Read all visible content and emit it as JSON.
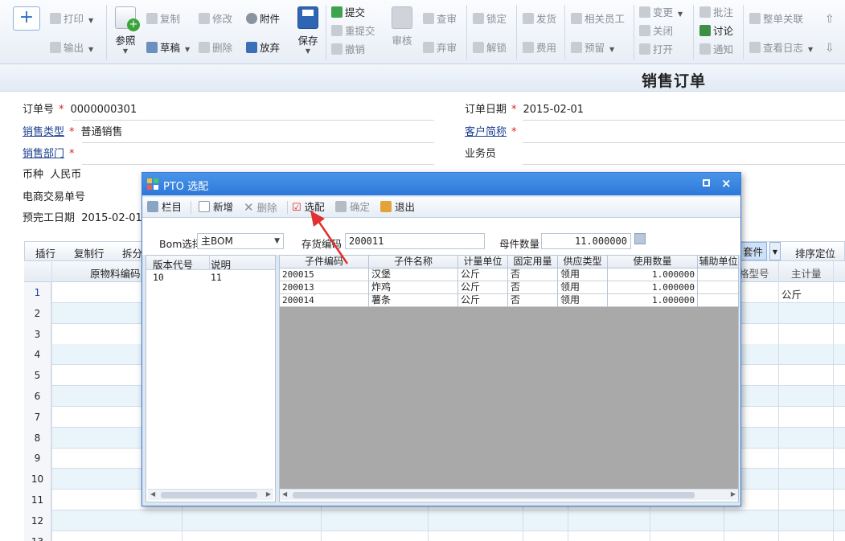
{
  "toolbar": {
    "add_symbol": "+",
    "print": "打印",
    "output": "输出",
    "reference": "参照",
    "copy": "复制",
    "draft": "草稿",
    "modify": "修改",
    "delete": "删除",
    "attach": "附件",
    "abandon": "放弃",
    "save": "保存",
    "submit": "提交",
    "resubmit": "重提交",
    "withdraw": "撤销",
    "audit": "审核",
    "review": "查审",
    "discard": "弃审",
    "lock": "锁定",
    "unlock": "解锁",
    "ship": "发货",
    "cost": "费用",
    "related": "相关员工",
    "reserve": "预留",
    "change": "变更",
    "close": "关闭",
    "open": "打开",
    "annotate": "批注",
    "discuss": "讨论",
    "notify": "通知",
    "whole_link": "整单关联",
    "view_log": "查看日志"
  },
  "form": {
    "title": "销售订单",
    "order_no_label": "订单号",
    "order_no": "0000000301",
    "order_date_label": "订单日期",
    "order_date": "2015-02-01",
    "sales_type_label": "销售类型",
    "sales_type": "普通销售",
    "customer_label": "客户简称",
    "customer": "",
    "dept_label": "销售部门",
    "dept": "",
    "salesman_label": "业务员",
    "salesman": "",
    "currency_label": "币种",
    "currency": "人民币",
    "ecommerce_label": "电商交易单号",
    "ecommerce": "",
    "finish_date_label": "预完工日期",
    "finish_date": "2015-02-01",
    "required_mark": "*"
  },
  "grid": {
    "tabs": [
      "插行",
      "复制行",
      "拆分"
    ],
    "tab_kit": "套件",
    "tab_sort": "排序定位",
    "col_material": "原物料编码",
    "col_spec": "格型号",
    "col_unit": "主计量",
    "row1_unit": "公斤",
    "row_numbers": [
      "1",
      "2",
      "3",
      "4",
      "5",
      "6",
      "7",
      "8",
      "9",
      "10",
      "11",
      "12",
      "13"
    ]
  },
  "dialog": {
    "title": "PTO 选配",
    "close_symbol": "×",
    "toolbar": {
      "columns": "栏目",
      "new": "新增",
      "delete": "删除",
      "select": "选配",
      "confirm": "确定",
      "exit": "退出"
    },
    "bom_label": "Bom选择",
    "bom_value": "主BOM",
    "stock_code_label": "存货编码",
    "stock_code": "200011",
    "parent_qty_label": "母件数量",
    "parent_qty": "11.000000",
    "left_table": {
      "headers": [
        "版本代号",
        "说明"
      ],
      "rows": [
        [
          "10",
          "11"
        ]
      ]
    },
    "right_table": {
      "headers": [
        "子件编码",
        "子件名称",
        "计量单位",
        "固定用量",
        "供应类型",
        "使用数量",
        "辅助单位"
      ],
      "rows": [
        [
          "200015",
          "汉堡",
          "公斤",
          "否",
          "领用",
          "1.000000"
        ],
        [
          "200013",
          "炸鸡",
          "公斤",
          "否",
          "领用",
          "1.000000"
        ],
        [
          "200014",
          "薯条",
          "公斤",
          "否",
          "领用",
          "1.000000"
        ]
      ]
    }
  },
  "colors": {
    "accent": "#2d78d8",
    "grid_alt_row": "#eaf4fb",
    "required": "#dd2222",
    "annotation_arrow": "#e23030"
  }
}
